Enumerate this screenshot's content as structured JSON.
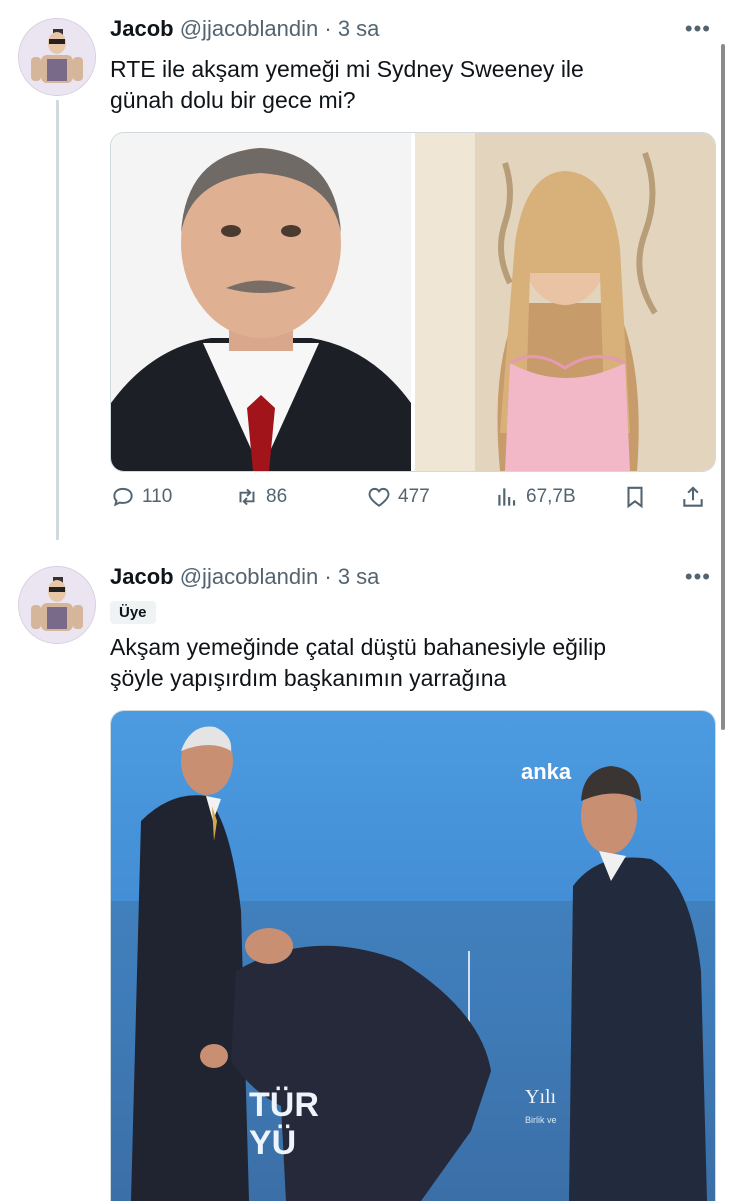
{
  "tweets": [
    {
      "display_name": "Jacob",
      "handle": "@jjacoblandin",
      "time": "3 sa",
      "text_line1": "RTE ile akşam yemeği mi Sydney Sweeney ile",
      "text_line2": "günah dolu bir gece mi?",
      "stats": {
        "replies": "110",
        "retweets": "86",
        "likes": "477",
        "views": "67,7B"
      }
    },
    {
      "display_name": "Jacob",
      "handle": "@jjacoblandin",
      "time": "3 sa",
      "badge": "Üye",
      "text_line1": "Akşam yemeğinde çatal düştü bahanesiyle eğilip",
      "text_line2": "şöyle yapışırdım başkanımın yarrağına",
      "media_text": {
        "logo": "anka",
        "sign1": "TÜR",
        "sign2": "YÜ",
        "sign3": "Yılı",
        "sign4": "Birlik ve"
      }
    }
  ],
  "ui": {
    "more_label": "•••",
    "separator": "·"
  },
  "colors": {
    "text": "#0f1419",
    "muted": "#536471",
    "line": "#cfd9de",
    "stage_blue": "#3f8fd6"
  }
}
